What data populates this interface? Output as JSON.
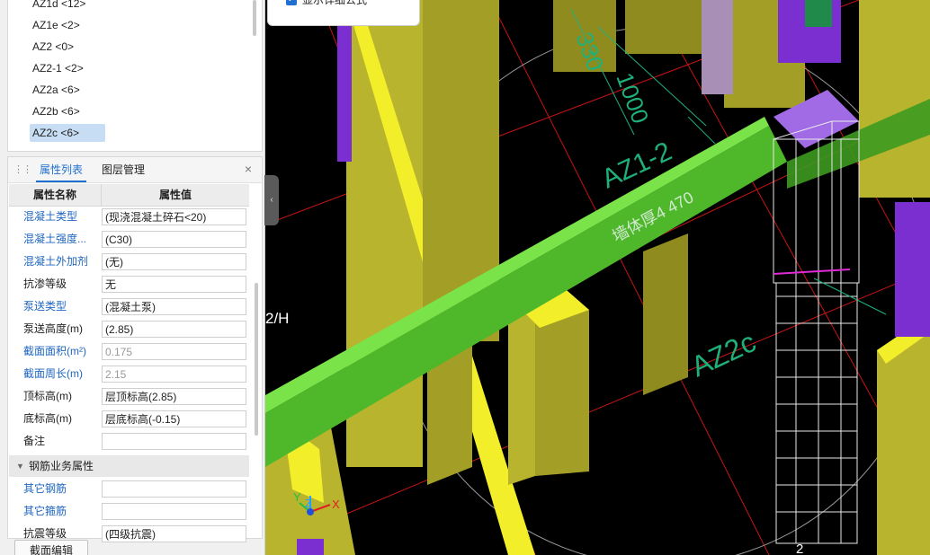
{
  "component_list": {
    "items": [
      {
        "label": "AZ1d <12>",
        "selected": false
      },
      {
        "label": "AZ1e <2>",
        "selected": false
      },
      {
        "label": "AZ2 <0>",
        "selected": false
      },
      {
        "label": "AZ2-1 <2>",
        "selected": false
      },
      {
        "label": "AZ2a <6>",
        "selected": false
      },
      {
        "label": "AZ2b <6>",
        "selected": false
      },
      {
        "label": "AZ2c <6>",
        "selected": true
      }
    ]
  },
  "panel": {
    "tabs": [
      {
        "label": "属性列表",
        "active": true
      },
      {
        "label": "图层管理",
        "active": false
      }
    ],
    "close_glyph": "×",
    "grid_headers": {
      "name": "属性名称",
      "value": "属性值"
    },
    "rows": [
      {
        "label": "混凝土类型",
        "value": "(现浇混凝土碎石<20)",
        "blue": true,
        "disabled": false
      },
      {
        "label": "混凝土强度...",
        "value": "(C30)",
        "blue": true,
        "disabled": false
      },
      {
        "label": "混凝土外加剂",
        "value": "(无)",
        "blue": true,
        "disabled": false
      },
      {
        "label": "抗渗等级",
        "value": "无",
        "blue": false,
        "disabled": false
      },
      {
        "label": "泵送类型",
        "value": "(混凝土泵)",
        "blue": true,
        "disabled": false
      },
      {
        "label": "泵送高度(m)",
        "value": "(2.85)",
        "blue": false,
        "disabled": false
      },
      {
        "label": "截面面积(m²)",
        "value": "0.175",
        "blue": true,
        "disabled": true
      },
      {
        "label": "截面周长(m)",
        "value": "2.15",
        "blue": true,
        "disabled": true
      },
      {
        "label": "顶标高(m)",
        "value": "层顶标高(2.85)",
        "blue": false,
        "disabled": false
      },
      {
        "label": "底标高(m)",
        "value": "层底标高(-0.15)",
        "blue": false,
        "disabled": false
      },
      {
        "label": "备注",
        "value": "",
        "blue": false,
        "disabled": false
      }
    ],
    "group": {
      "label": "钢筋业务属性"
    },
    "rows2": [
      {
        "label": "其它钢筋",
        "value": "",
        "blue": true
      },
      {
        "label": "其它箍筋",
        "value": "",
        "blue": true
      },
      {
        "label": "抗震等级",
        "value": "(四级抗震)",
        "blue": false
      }
    ]
  },
  "buttons": {
    "section_edit": "截面编辑"
  },
  "popup": {
    "label": "显示详细公式",
    "checked": true
  },
  "viewport": {
    "labels": {
      "az1_2": "AZ1-2",
      "az2c": "AZ2c",
      "dim_1000": "1000",
      "dim_330": "330",
      "wall_label": "墙体厚4 470",
      "grid_2h": "2/H",
      "grid_bottom": "2"
    },
    "axes": {
      "x": "X",
      "y": "Y",
      "z": "Z"
    },
    "colors": {
      "background": "#000000",
      "green_beam": "#5fd22f",
      "yellow_wall": "#b9b42d",
      "yellow_edge": "#f3ee2a",
      "purple": "#7b2fd0",
      "grid_red": "#c81414",
      "annotation": "#1fb07a"
    }
  }
}
